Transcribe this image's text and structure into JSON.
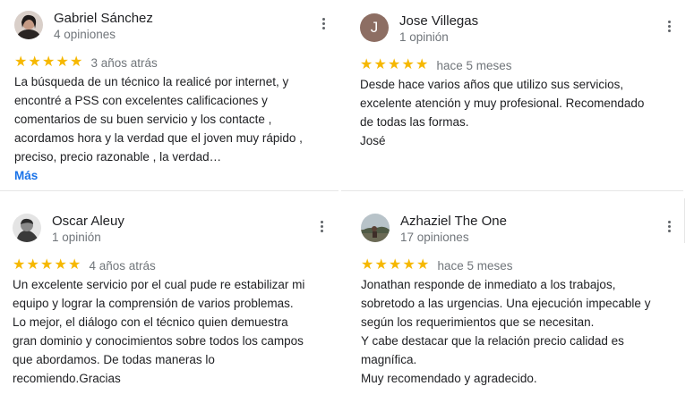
{
  "colors": {
    "star": "#f6b800",
    "link": "#1a73e8",
    "avatar_j": "#8d6e63"
  },
  "icons": {
    "star": "star-icon",
    "menu": "more-vert-icon"
  },
  "reviews": [
    {
      "name": "Gabriel Sánchez",
      "count": "4 opiniones",
      "stars": 5,
      "date": "3 años atrás",
      "lines": [
        "La búsqueda de un técnico la realicé por internet,  y",
        "encontré a PSS con excelentes calificaciones y",
        "comentarios de su buen servicio y los contacte ,",
        "acordamos hora y la verdad que el joven muy rápido ,",
        "preciso, precio razonable , la verdad…"
      ],
      "more": "Más"
    },
    {
      "name": "Jose Villegas",
      "count": "1 opinión",
      "avatar_letter": "J",
      "stars": 5,
      "date": "hace 5 meses",
      "lines": [
        "Desde hace varios años que utilizo sus servicios,",
        "excelente atención y muy profesional. Recomendado",
        "de todas las formas.",
        "José"
      ]
    },
    {
      "name": "Oscar Aleuy",
      "count": "1 opinión",
      "stars": 5,
      "date": "4 años atrás",
      "lines": [
        "Un excelente servicio por el cual pude re estabilizar mi",
        "equipo y lograr la comprensión de varios problemas.",
        "Lo mejor, el diálogo con el técnico quien demuestra",
        "gran dominio y conocimientos sobre todos los campos",
        "que abordamos. De todas maneras lo",
        "recomiendo.Gracias"
      ]
    },
    {
      "name": "Azhaziel The One",
      "count": "17 opiniones",
      "stars": 5,
      "date": "hace 5 meses",
      "lines": [
        "Jonathan responde de inmediato a los trabajos,",
        "sobretodo a las urgencias. Una ejecución impecable y",
        "según los requerimientos que se necesitan.",
        "Y cabe destacar que la relación precio calidad es",
        "magnífica.",
        "Muy recomendado y agradecido."
      ]
    }
  ]
}
